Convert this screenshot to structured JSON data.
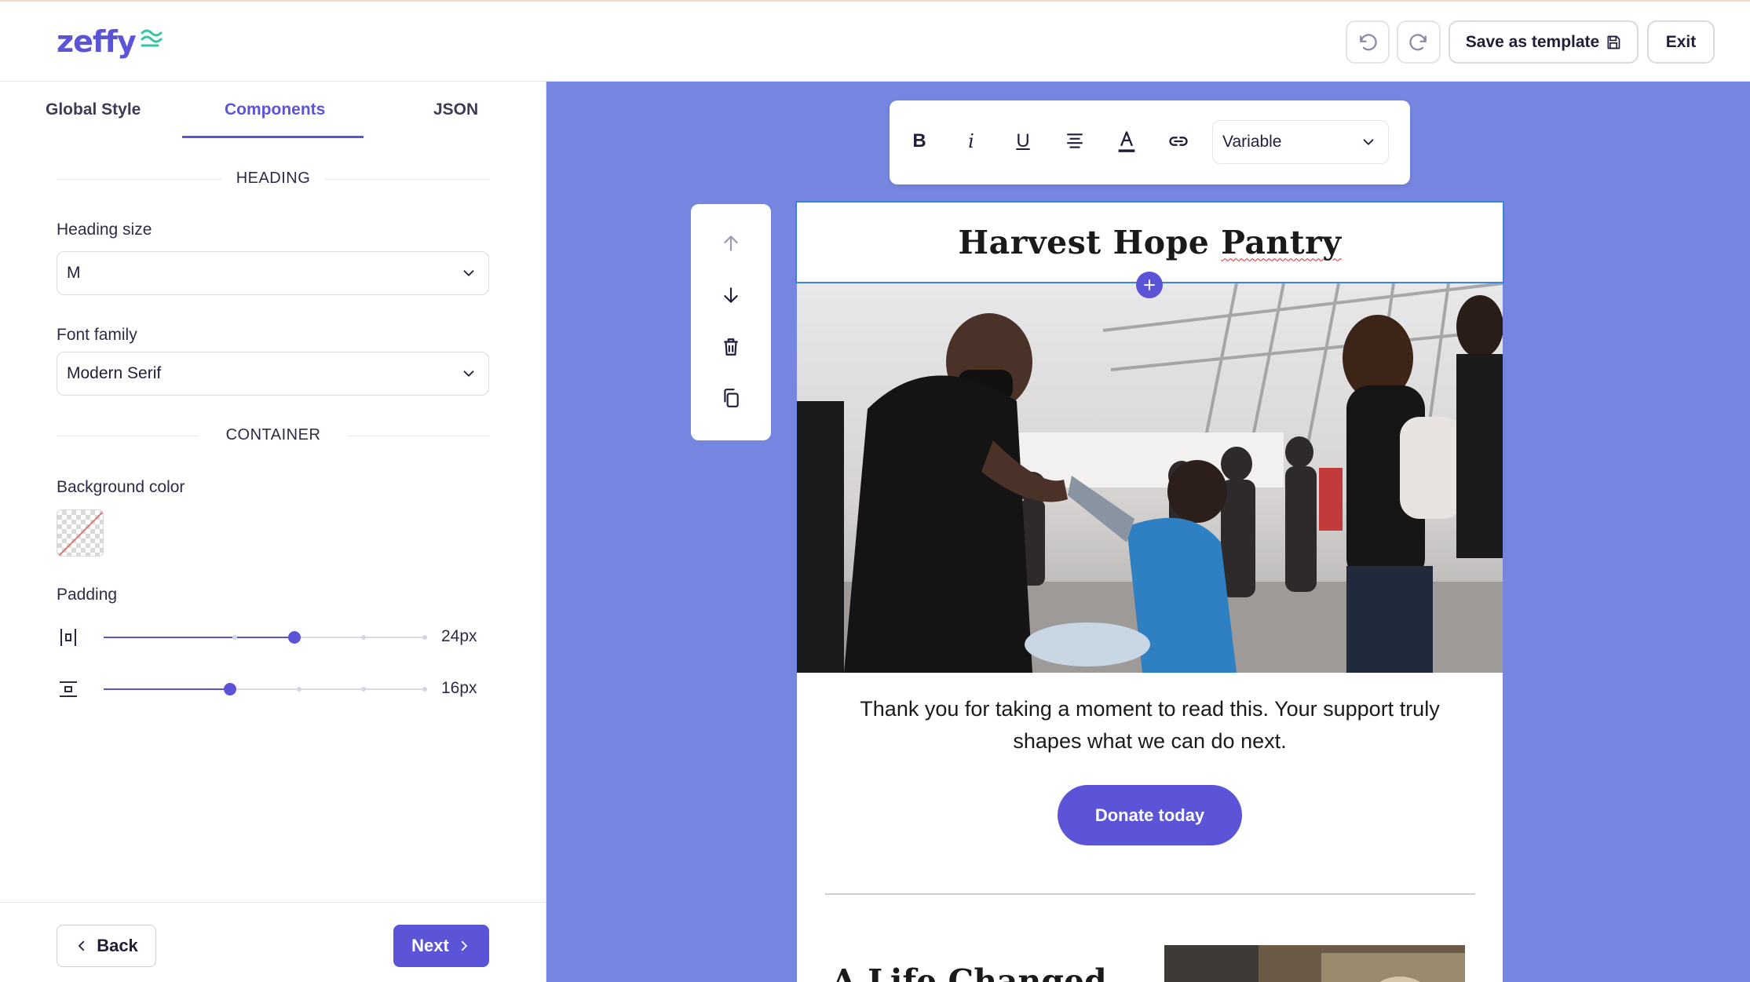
{
  "app": {
    "logo_text": "zeffy",
    "brand_color": "#5b54d6"
  },
  "toolbar": {
    "undo_icon": "undo-icon",
    "redo_icon": "redo-icon",
    "save_template_label": "Save as template",
    "exit_label": "Exit"
  },
  "left_panel": {
    "tabs": [
      {
        "label": "Global Style",
        "active": false
      },
      {
        "label": "Components",
        "active": true
      },
      {
        "label": "JSON",
        "active": false
      }
    ],
    "heading_section": {
      "title": "HEADING",
      "size_label": "Heading size",
      "size_value": "M",
      "font_label": "Font family",
      "font_value": "Modern Serif"
    },
    "container_section": {
      "title": "CONTAINER",
      "bg_label": "Background color",
      "padding_label": "Padding",
      "horizontal_padding": {
        "value": "24px",
        "fraction": 0.59
      },
      "vertical_padding": {
        "value": "16px",
        "fraction": 0.39
      }
    },
    "footer": {
      "back_label": "Back",
      "next_label": "Next"
    }
  },
  "editor": {
    "format_bar": {
      "bold": "B",
      "italic": "i",
      "underline": "U",
      "variable_select": "Variable"
    },
    "email": {
      "heading_pre": "Harvest Hope ",
      "heading_misspelt": "Pantry",
      "body_text": "Thank you for taking a moment to read this. Your support truly shapes what we can do next.",
      "donate_label": "Donate today",
      "next_heading_partial": "A Life Changed"
    },
    "canvas_color": "#7585e0"
  }
}
